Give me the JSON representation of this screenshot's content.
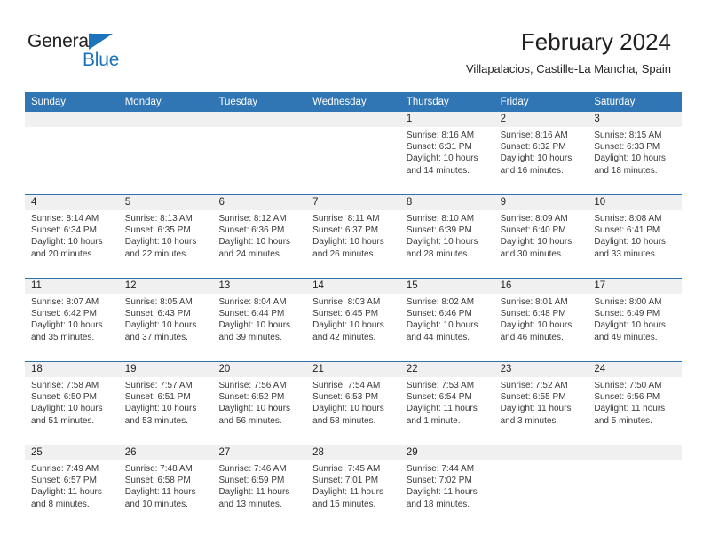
{
  "brand": {
    "line1": "General",
    "line2": "Blue",
    "triangle_icon": "brand-triangle-icon",
    "black": "#221f1f",
    "blue": "#1b74bb"
  },
  "header": {
    "title": "February 2024",
    "subtitle": "Villapalacios, Castille-La Mancha, Spain"
  },
  "colors": {
    "header_blue": "#3075b4",
    "row_separator_blue": "#2e72b0",
    "date_strip_gray": "#f0f0f0",
    "text": "#231f20"
  },
  "calendar": {
    "weekdays": [
      "Sunday",
      "Monday",
      "Tuesday",
      "Wednesday",
      "Thursday",
      "Friday",
      "Saturday"
    ],
    "weeks": [
      [
        {
          "day": "",
          "lines": []
        },
        {
          "day": "",
          "lines": []
        },
        {
          "day": "",
          "lines": []
        },
        {
          "day": "",
          "lines": []
        },
        {
          "day": "1",
          "lines": [
            "Sunrise: 8:16 AM",
            "Sunset: 6:31 PM",
            "Daylight: 10 hours",
            "and 14 minutes."
          ]
        },
        {
          "day": "2",
          "lines": [
            "Sunrise: 8:16 AM",
            "Sunset: 6:32 PM",
            "Daylight: 10 hours",
            "and 16 minutes."
          ]
        },
        {
          "day": "3",
          "lines": [
            "Sunrise: 8:15 AM",
            "Sunset: 6:33 PM",
            "Daylight: 10 hours",
            "and 18 minutes."
          ]
        }
      ],
      [
        {
          "day": "4",
          "lines": [
            "Sunrise: 8:14 AM",
            "Sunset: 6:34 PM",
            "Daylight: 10 hours",
            "and 20 minutes."
          ]
        },
        {
          "day": "5",
          "lines": [
            "Sunrise: 8:13 AM",
            "Sunset: 6:35 PM",
            "Daylight: 10 hours",
            "and 22 minutes."
          ]
        },
        {
          "day": "6",
          "lines": [
            "Sunrise: 8:12 AM",
            "Sunset: 6:36 PM",
            "Daylight: 10 hours",
            "and 24 minutes."
          ]
        },
        {
          "day": "7",
          "lines": [
            "Sunrise: 8:11 AM",
            "Sunset: 6:37 PM",
            "Daylight: 10 hours",
            "and 26 minutes."
          ]
        },
        {
          "day": "8",
          "lines": [
            "Sunrise: 8:10 AM",
            "Sunset: 6:39 PM",
            "Daylight: 10 hours",
            "and 28 minutes."
          ]
        },
        {
          "day": "9",
          "lines": [
            "Sunrise: 8:09 AM",
            "Sunset: 6:40 PM",
            "Daylight: 10 hours",
            "and 30 minutes."
          ]
        },
        {
          "day": "10",
          "lines": [
            "Sunrise: 8:08 AM",
            "Sunset: 6:41 PM",
            "Daylight: 10 hours",
            "and 33 minutes."
          ]
        }
      ],
      [
        {
          "day": "11",
          "lines": [
            "Sunrise: 8:07 AM",
            "Sunset: 6:42 PM",
            "Daylight: 10 hours",
            "and 35 minutes."
          ]
        },
        {
          "day": "12",
          "lines": [
            "Sunrise: 8:05 AM",
            "Sunset: 6:43 PM",
            "Daylight: 10 hours",
            "and 37 minutes."
          ]
        },
        {
          "day": "13",
          "lines": [
            "Sunrise: 8:04 AM",
            "Sunset: 6:44 PM",
            "Daylight: 10 hours",
            "and 39 minutes."
          ]
        },
        {
          "day": "14",
          "lines": [
            "Sunrise: 8:03 AM",
            "Sunset: 6:45 PM",
            "Daylight: 10 hours",
            "and 42 minutes."
          ]
        },
        {
          "day": "15",
          "lines": [
            "Sunrise: 8:02 AM",
            "Sunset: 6:46 PM",
            "Daylight: 10 hours",
            "and 44 minutes."
          ]
        },
        {
          "day": "16",
          "lines": [
            "Sunrise: 8:01 AM",
            "Sunset: 6:48 PM",
            "Daylight: 10 hours",
            "and 46 minutes."
          ]
        },
        {
          "day": "17",
          "lines": [
            "Sunrise: 8:00 AM",
            "Sunset: 6:49 PM",
            "Daylight: 10 hours",
            "and 49 minutes."
          ]
        }
      ],
      [
        {
          "day": "18",
          "lines": [
            "Sunrise: 7:58 AM",
            "Sunset: 6:50 PM",
            "Daylight: 10 hours",
            "and 51 minutes."
          ]
        },
        {
          "day": "19",
          "lines": [
            "Sunrise: 7:57 AM",
            "Sunset: 6:51 PM",
            "Daylight: 10 hours",
            "and 53 minutes."
          ]
        },
        {
          "day": "20",
          "lines": [
            "Sunrise: 7:56 AM",
            "Sunset: 6:52 PM",
            "Daylight: 10 hours",
            "and 56 minutes."
          ]
        },
        {
          "day": "21",
          "lines": [
            "Sunrise: 7:54 AM",
            "Sunset: 6:53 PM",
            "Daylight: 10 hours",
            "and 58 minutes."
          ]
        },
        {
          "day": "22",
          "lines": [
            "Sunrise: 7:53 AM",
            "Sunset: 6:54 PM",
            "Daylight: 11 hours",
            "and 1 minute."
          ]
        },
        {
          "day": "23",
          "lines": [
            "Sunrise: 7:52 AM",
            "Sunset: 6:55 PM",
            "Daylight: 11 hours",
            "and 3 minutes."
          ]
        },
        {
          "day": "24",
          "lines": [
            "Sunrise: 7:50 AM",
            "Sunset: 6:56 PM",
            "Daylight: 11 hours",
            "and 5 minutes."
          ]
        }
      ],
      [
        {
          "day": "25",
          "lines": [
            "Sunrise: 7:49 AM",
            "Sunset: 6:57 PM",
            "Daylight: 11 hours",
            "and 8 minutes."
          ]
        },
        {
          "day": "26",
          "lines": [
            "Sunrise: 7:48 AM",
            "Sunset: 6:58 PM",
            "Daylight: 11 hours",
            "and 10 minutes."
          ]
        },
        {
          "day": "27",
          "lines": [
            "Sunrise: 7:46 AM",
            "Sunset: 6:59 PM",
            "Daylight: 11 hours",
            "and 13 minutes."
          ]
        },
        {
          "day": "28",
          "lines": [
            "Sunrise: 7:45 AM",
            "Sunset: 7:01 PM",
            "Daylight: 11 hours",
            "and 15 minutes."
          ]
        },
        {
          "day": "29",
          "lines": [
            "Sunrise: 7:44 AM",
            "Sunset: 7:02 PM",
            "Daylight: 11 hours",
            "and 18 minutes."
          ]
        },
        {
          "day": "",
          "lines": []
        },
        {
          "day": "",
          "lines": []
        }
      ]
    ]
  }
}
